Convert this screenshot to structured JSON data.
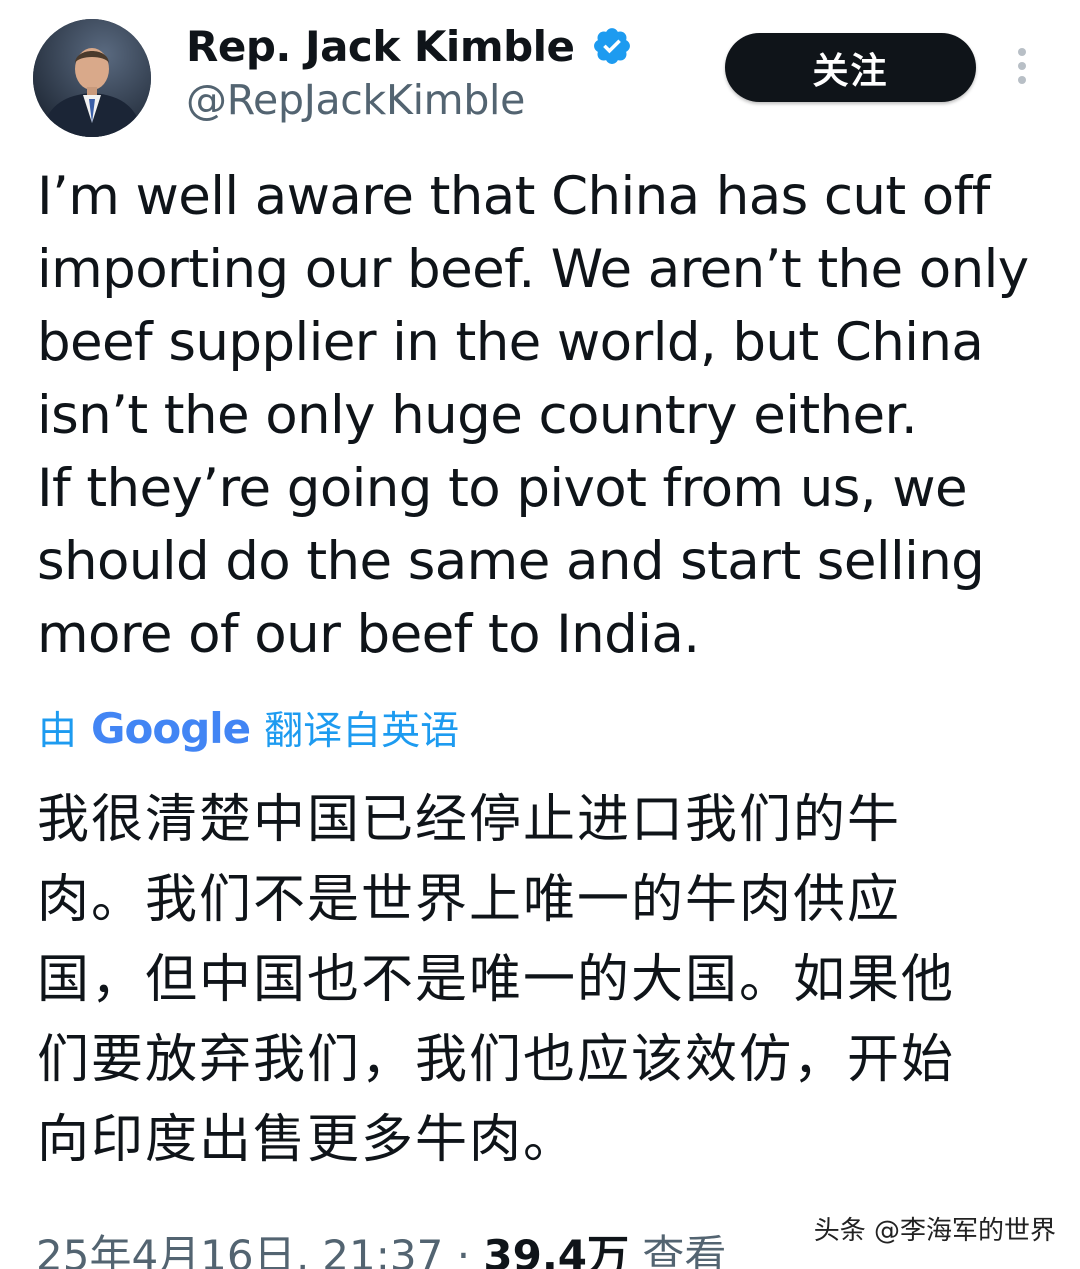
{
  "author": {
    "display_name": "Rep. Jack Kimble",
    "handle": "@RepJackKimble",
    "verified": true,
    "avatar": "profile-photo-man-in-suit"
  },
  "actions": {
    "follow_label": "关注",
    "more_icon": "vertical-ellipsis-icon"
  },
  "tweet": {
    "lines": [
      "I’m well aware that China has cut off",
      "importing our beef. We aren’t the only",
      "beef supplier in the world, but China",
      "isn’t the only huge country either.",
      "If they’re going to pivot from us, we",
      "should do the same and start selling",
      "more of our beef to India."
    ]
  },
  "translation": {
    "prefix": "由",
    "provider": "Google",
    "suffix": "翻译自英语",
    "lines": [
      "我很清楚中国已经停止进口我们的牛",
      "肉。我们不是世界上唯一的牛肉供应",
      "国，但中国也不是唯一的大国。如果他",
      "们要放弃我们，我们也应该效仿，开始",
      "向印度出售更多牛肉。"
    ]
  },
  "footer": {
    "timestamp": "25年4月16日, 21:37 · ",
    "views_count": "39.4万",
    "views_label": " 查看"
  },
  "watermark": "头条 @李海军的世界",
  "colors": {
    "text": "#0f1419",
    "secondary": "#536471",
    "accent": "#1d9bf0",
    "button_bg": "#0f1419"
  }
}
